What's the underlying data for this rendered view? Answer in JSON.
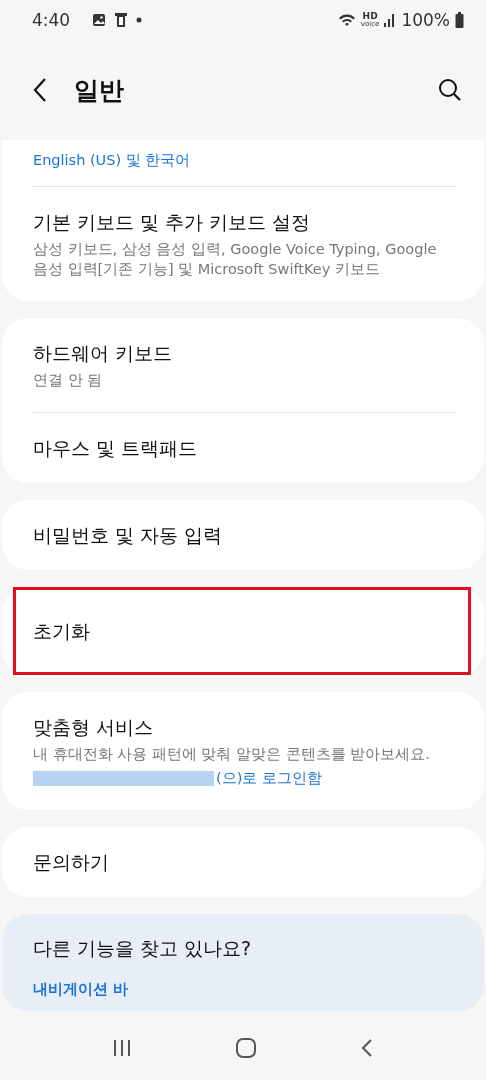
{
  "status_bar": {
    "time": "4:40",
    "hd": "HD",
    "voice": "voice",
    "battery": "100%"
  },
  "header": {
    "title": "일반"
  },
  "groups": [
    {
      "items": [
        {
          "kind": "cut",
          "subtitle": "English (US) 및 한국어",
          "subtitle_link": true,
          "highlighted": false
        },
        {
          "kind": "plain",
          "title": "기본 키보드 및 추가 키보드 설정",
          "subtitle": "삼성 키보드, 삼성 음성 입력, Google Voice Typing, Google 음성 입력[기존 기능] 및 Microsoft SwiftKey 키보드",
          "subtitle_link": false,
          "highlighted": false
        }
      ]
    },
    {
      "items": [
        {
          "kind": "plain",
          "title": "하드웨어 키보드",
          "subtitle": "연결 안 됨",
          "subtitle_link": false,
          "highlighted": false
        },
        {
          "kind": "plain",
          "title": "마우스 및 트랙패드",
          "highlighted": false
        }
      ]
    },
    {
      "items": [
        {
          "kind": "plain",
          "title": "비밀번호 및 자동 입력",
          "highlighted": false
        }
      ]
    },
    {
      "items": [
        {
          "kind": "plain",
          "title": "초기화",
          "highlighted": true
        }
      ]
    },
    {
      "items": [
        {
          "kind": "account",
          "title": "맞춤형 서비스",
          "subtitle": "내 휴대전화 사용 패턴에 맞춰 알맞은 콘텐츠를 받아보세요.",
          "subtitle_link": false,
          "account_text": "(으)로 로그인함",
          "highlighted": false
        }
      ]
    },
    {
      "items": [
        {
          "kind": "plain",
          "title": "문의하기",
          "highlighted": false
        }
      ]
    }
  ],
  "suggestions": {
    "title": "다른 기능을 찾고 있나요?",
    "link": "내비게이션 바"
  }
}
